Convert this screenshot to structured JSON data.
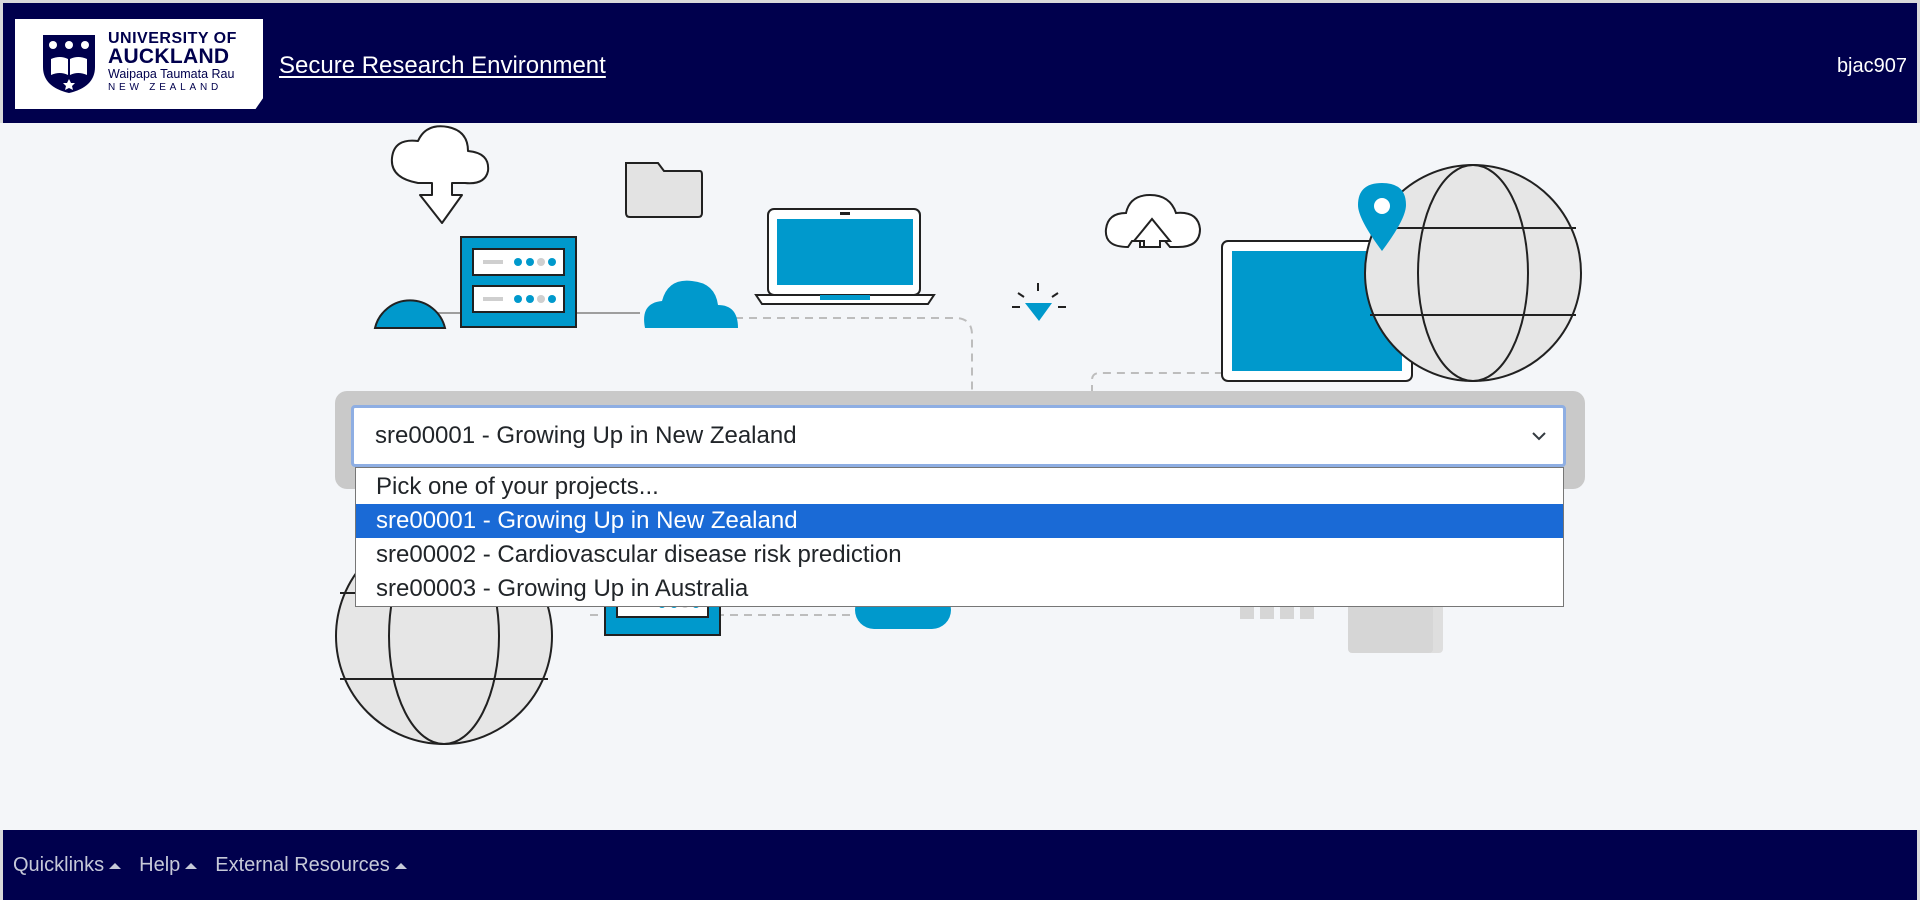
{
  "header": {
    "logo": {
      "line1": "UNIVERSITY OF",
      "line2": "AUCKLAND",
      "line3": "Waipapa Taumata Rau",
      "line4": "NEW ZEALAND"
    },
    "app_title": "Secure Research Environment",
    "username": "bjac907"
  },
  "project_select": {
    "selected_value": "sre00001 - Growing Up in New Zealand",
    "options": [
      {
        "label": "Pick one of your projects..."
      },
      {
        "label": "sre00001 - Growing Up in New Zealand",
        "selected": true
      },
      {
        "label": "sre00002 - Cardiovascular disease risk prediction"
      },
      {
        "label": "sre00003 - Growing Up in Australia"
      }
    ]
  },
  "footer": {
    "links": [
      {
        "label": "Quicklinks",
        "icon": "caret-up-icon"
      },
      {
        "label": "Help",
        "icon": "caret-up-icon"
      },
      {
        "label": "External Resources",
        "icon": "caret-up-icon"
      }
    ]
  },
  "colors": {
    "navy": "#00004d",
    "accent_blue": "#0099cc",
    "selection_blue": "#1a6ad6",
    "background": "#f4f6f9"
  }
}
